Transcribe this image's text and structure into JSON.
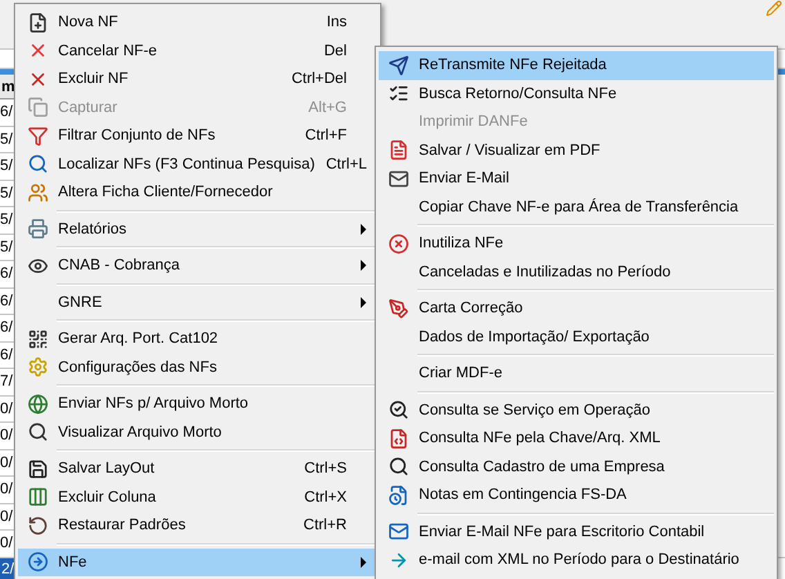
{
  "grid": {
    "header": "m",
    "left_cells": [
      "6/",
      "5/",
      "5/",
      "5/",
      "5/",
      "5/",
      "6/",
      "6/",
      "6/",
      "6/",
      "7/",
      "0/",
      "0/",
      "0/",
      "0/",
      "0/",
      "0/"
    ],
    "bottom_row": [
      {
        "text": "2/",
        "selected": true
      }
    ]
  },
  "menu": {
    "items": [
      {
        "kind": "item",
        "label": "Nova NF",
        "shortcut": "Ins",
        "disabled": false,
        "selected": false
      },
      {
        "kind": "item",
        "label": "Cancelar NF-e",
        "shortcut": "Del",
        "disabled": false,
        "selected": false
      },
      {
        "kind": "item",
        "label": "Excluir NF",
        "shortcut": "Ctrl+Del",
        "disabled": false,
        "selected": false
      },
      {
        "kind": "item",
        "label": "Capturar",
        "shortcut": "Alt+G",
        "disabled": true,
        "selected": false
      },
      {
        "kind": "item",
        "label": "Filtrar Conjunto de NFs",
        "shortcut": "Ctrl+F",
        "disabled": false,
        "selected": false
      },
      {
        "kind": "item",
        "label": "Localizar NFs (F3 Continua Pesquisa)",
        "shortcut": "Ctrl+L",
        "disabled": false,
        "selected": false
      },
      {
        "kind": "item",
        "label": "Altera Ficha Cliente/Fornecedor",
        "disabled": false,
        "selected": false,
        "submenu": false
      },
      {
        "kind": "separator"
      },
      {
        "kind": "item",
        "label": "Relatórios",
        "disabled": false,
        "selected": false,
        "submenu": true
      },
      {
        "kind": "separator"
      },
      {
        "kind": "item",
        "label": "CNAB - Cobrança",
        "disabled": false,
        "selected": false,
        "submenu": true
      },
      {
        "kind": "separator"
      },
      {
        "kind": "item",
        "label": "GNRE",
        "disabled": false,
        "selected": false,
        "submenu": true
      },
      {
        "kind": "separator"
      },
      {
        "kind": "item",
        "label": "Gerar Arq. Port. Cat102",
        "disabled": false,
        "selected": false,
        "submenu": false
      },
      {
        "kind": "item",
        "label": "Configurações das NFs",
        "disabled": false,
        "selected": false,
        "submenu": false
      },
      {
        "kind": "separator"
      },
      {
        "kind": "item",
        "label": "Enviar NFs p/ Arquivo Morto",
        "disabled": false,
        "selected": false,
        "submenu": false
      },
      {
        "kind": "item",
        "label": "Visualizar Arquivo Morto",
        "disabled": false,
        "selected": false,
        "submenu": false
      },
      {
        "kind": "separator"
      },
      {
        "kind": "item",
        "label": "Salvar LayOut",
        "shortcut": "Ctrl+S",
        "disabled": false,
        "selected": false
      },
      {
        "kind": "item",
        "label": "Excluir Coluna",
        "shortcut": "Ctrl+X",
        "disabled": false,
        "selected": false
      },
      {
        "kind": "item",
        "label": "Restaurar Padrões",
        "shortcut": "Ctrl+R",
        "disabled": false,
        "selected": false
      },
      {
        "kind": "separator"
      },
      {
        "kind": "item",
        "label": "NFe",
        "disabled": false,
        "selected": true,
        "submenu": true
      }
    ]
  },
  "submenu": {
    "items": [
      {
        "kind": "item",
        "label": "ReTransmite NFe Rejeitada",
        "disabled": false,
        "selected": true
      },
      {
        "kind": "item",
        "label": "Busca Retorno/Consulta NFe",
        "disabled": false,
        "selected": false
      },
      {
        "kind": "item",
        "label": "Imprimir DANFe",
        "disabled": true,
        "selected": false
      },
      {
        "kind": "item",
        "label": "Salvar / Visualizar em PDF",
        "disabled": false,
        "selected": false
      },
      {
        "kind": "item",
        "label": "Enviar E-Mail",
        "disabled": false,
        "selected": false
      },
      {
        "kind": "item",
        "label": "Copiar Chave NF-e para Área de Transferência",
        "disabled": false,
        "selected": false
      },
      {
        "kind": "separator"
      },
      {
        "kind": "item",
        "label": "Inutiliza NFe",
        "disabled": false,
        "selected": false
      },
      {
        "kind": "item",
        "label": "Canceladas e Inutilizadas no Período",
        "disabled": false,
        "selected": false
      },
      {
        "kind": "separator"
      },
      {
        "kind": "item",
        "label": "Carta Correção",
        "disabled": false,
        "selected": false
      },
      {
        "kind": "item",
        "label": "Dados de Importação/ Exportação",
        "disabled": false,
        "selected": false
      },
      {
        "kind": "separator"
      },
      {
        "kind": "item",
        "label": "Criar MDF-e",
        "disabled": false,
        "selected": false
      },
      {
        "kind": "separator"
      },
      {
        "kind": "item",
        "label": "Consulta se Serviço em Operação",
        "disabled": false,
        "selected": false
      },
      {
        "kind": "item",
        "label": "Consulta NFe pela Chave/Arq. XML",
        "disabled": false,
        "selected": false
      },
      {
        "kind": "item",
        "label": "Consulta Cadastro de uma Empresa",
        "disabled": false,
        "selected": false
      },
      {
        "kind": "item",
        "label": "Notas em Contingencia FS-DA",
        "disabled": false,
        "selected": false
      },
      {
        "kind": "separator"
      },
      {
        "kind": "item",
        "label": "Enviar E-Mail NFe para Escritorio Contabil",
        "disabled": false,
        "selected": false
      },
      {
        "kind": "item",
        "label": "e-mail com XML no Período para o Destinatário",
        "disabled": false,
        "selected": false
      }
    ]
  }
}
